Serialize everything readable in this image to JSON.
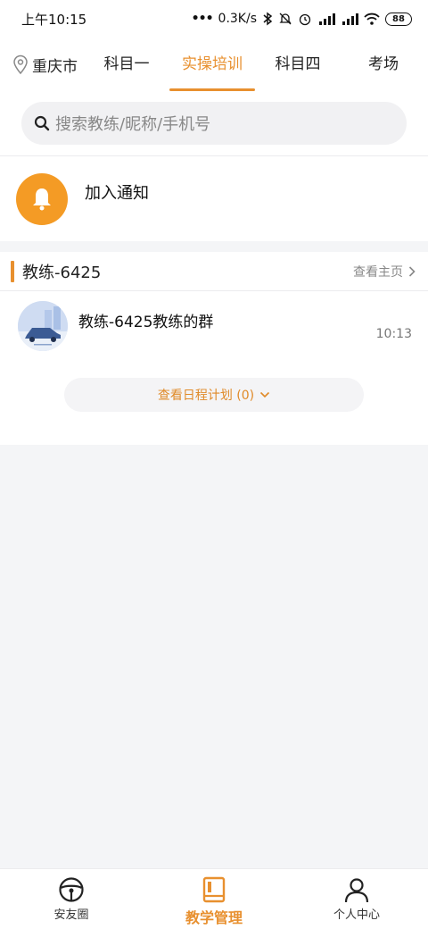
{
  "status_bar": {
    "time": "上午10:15",
    "network_speed": "0.3K/s",
    "battery": "88"
  },
  "top_nav": {
    "city": "重庆市",
    "tabs": [
      {
        "label": "科目一",
        "active": false
      },
      {
        "label": "实操培训",
        "active": true
      },
      {
        "label": "科目四",
        "active": false
      },
      {
        "label": "考场",
        "active": false
      }
    ]
  },
  "search": {
    "placeholder": "搜索教练/昵称/手机号"
  },
  "notice": {
    "label": "加入通知"
  },
  "coach": {
    "name": "教练-6425",
    "view_home": "查看主页",
    "group": {
      "name": "教练-6425教练的群",
      "time": "10:13"
    },
    "schedule_button": "查看日程计划 (0)"
  },
  "bottom_nav": {
    "items": [
      {
        "label": "安友圈",
        "icon": "steering-wheel-icon",
        "active": false
      },
      {
        "label": "教学管理",
        "icon": "book-icon",
        "active": true
      },
      {
        "label": "个人中心",
        "icon": "person-icon",
        "active": false
      }
    ]
  },
  "colors": {
    "accent": "#e8902f",
    "bell": "#f49b25",
    "background": "#f4f5f7"
  }
}
